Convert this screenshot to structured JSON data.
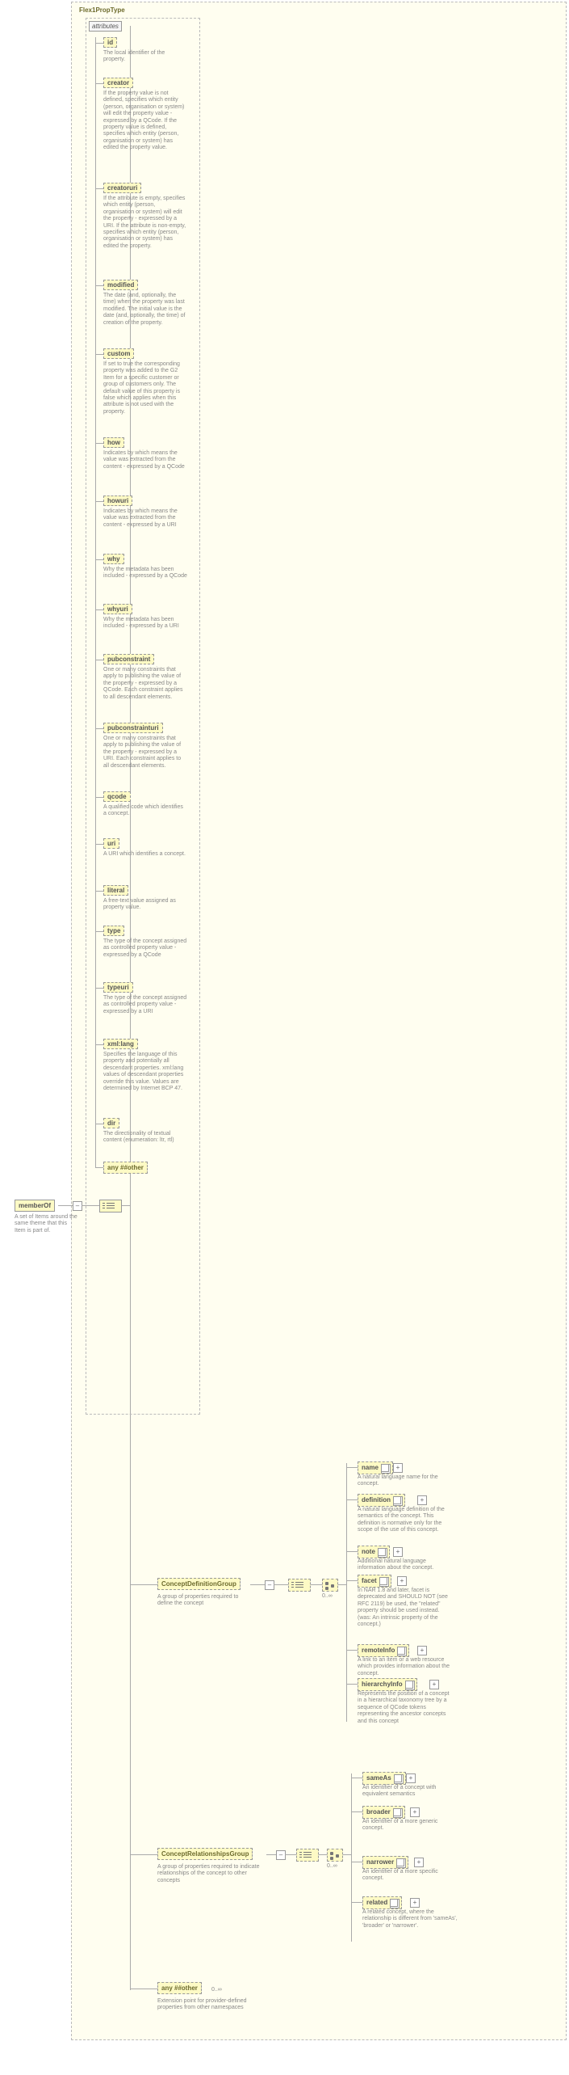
{
  "root": {
    "label": "Flex1PropType",
    "desc": ""
  },
  "memberOf": {
    "label": "memberOf",
    "desc": "A set of Items around the same theme that this Item is part of."
  },
  "attributesLabel": "attributes",
  "attrs": [
    {
      "name": "id",
      "desc": "The local identifier of the property."
    },
    {
      "name": "creator",
      "desc": "If the property value is not defined, specifies which entity (person, organisation or system) will edit the property value - expressed by a QCode. If the property value is defined, specifies which entity (person, organisation or system) has edited the property value."
    },
    {
      "name": "creatoruri",
      "desc": "If the attribute is empty, specifies which entity (person, organisation or system) will edit the property - expressed by a URI. If the attribute is non-empty, specifies which entity (person, organisation or system) has edited the property."
    },
    {
      "name": "modified",
      "desc": "The date (and, optionally, the time) when the property was last modified. The initial value is the date (and, optionally, the time) of creation of the property."
    },
    {
      "name": "custom",
      "desc": "If set to true the corresponding property was added to the G2 Item for a specific customer or group of customers only. The default value of this property is false which applies when this attribute is not used with the property."
    },
    {
      "name": "how",
      "desc": "Indicates by which means the value was extracted from the content - expressed by a QCode"
    },
    {
      "name": "howuri",
      "desc": "Indicates by which means the value was extracted from the content - expressed by a URI"
    },
    {
      "name": "why",
      "desc": "Why the metadata has been included - expressed by a QCode"
    },
    {
      "name": "whyuri",
      "desc": "Why the metadata has been included - expressed by a URI"
    },
    {
      "name": "pubconstraint",
      "desc": "One or many constraints that apply to publishing the value of the property - expressed by a QCode. Each constraint applies to all descendant elements."
    },
    {
      "name": "pubconstrainturi",
      "desc": "One or many constraints that apply to publishing the value of the property - expressed by a URI. Each constraint applies to all descendant elements."
    },
    {
      "name": "qcode",
      "desc": "A qualified code which identifies a concept."
    },
    {
      "name": "uri",
      "desc": "A URI which identifies a concept."
    },
    {
      "name": "literal",
      "desc": "A free-text value assigned as property value."
    },
    {
      "name": "type",
      "desc": "The type of the concept assigned as controlled property value - expressed by a QCode"
    },
    {
      "name": "typeuri",
      "desc": "The type of the concept assigned as controlled property value - expressed by a URI"
    },
    {
      "name": "xml:lang",
      "desc": "Specifies the language of this property and potentially all descendant properties. xml:lang values of descendant properties override this value. Values are determined by Internet BCP 47."
    },
    {
      "name": "dir",
      "desc": "The directionality of textual content (enumeration: ltr, rtl)"
    },
    {
      "name": "",
      "desc": "",
      "any": "any ##other"
    }
  ],
  "groups": {
    "def": {
      "label": "ConceptDefinitionGroup",
      "desc": "A group of properties required to define the concept"
    },
    "rel": {
      "label": "ConceptRelationshipsGroup",
      "desc": "A group of properties required to indicate relationships of the concept to other concepts"
    }
  },
  "defChildren": [
    {
      "name": "name",
      "desc": "A natural language name for the concept."
    },
    {
      "name": "definition",
      "desc": "A natural language definition of the semantics of the concept. This definition is normative only for the scope of the use of this concept."
    },
    {
      "name": "note",
      "desc": "Additional natural language information about the concept."
    },
    {
      "name": "facet",
      "desc": "In NAR 1.8 and later, facet is deprecated and SHOULD NOT (see RFC 2119) be used, the \"related\" property should be used instead.(was: An intrinsic property of the concept.)"
    },
    {
      "name": "remoteInfo",
      "desc": "A link to an item or a web resource which provides information about the concept."
    },
    {
      "name": "hierarchyInfo",
      "desc": "Represents the position of a concept in a hierarchical taxonomy tree by a sequence of QCode tokens representing the ancestor concepts and this concept"
    }
  ],
  "relChildren": [
    {
      "name": "sameAs",
      "desc": "An identifier of a concept with equivalent semantics"
    },
    {
      "name": "broader",
      "desc": "An identifier of a more generic concept."
    },
    {
      "name": "narrower",
      "desc": "An identifier of a more specific concept."
    },
    {
      "name": "related",
      "desc": "A related concept, where the relationship is different from 'sameAs', 'broader' or 'narrower'."
    }
  ],
  "ext": {
    "any": "any ##other",
    "desc": "Extension point for provider-defined properties from other namespaces"
  },
  "cardinality": "0..∞"
}
